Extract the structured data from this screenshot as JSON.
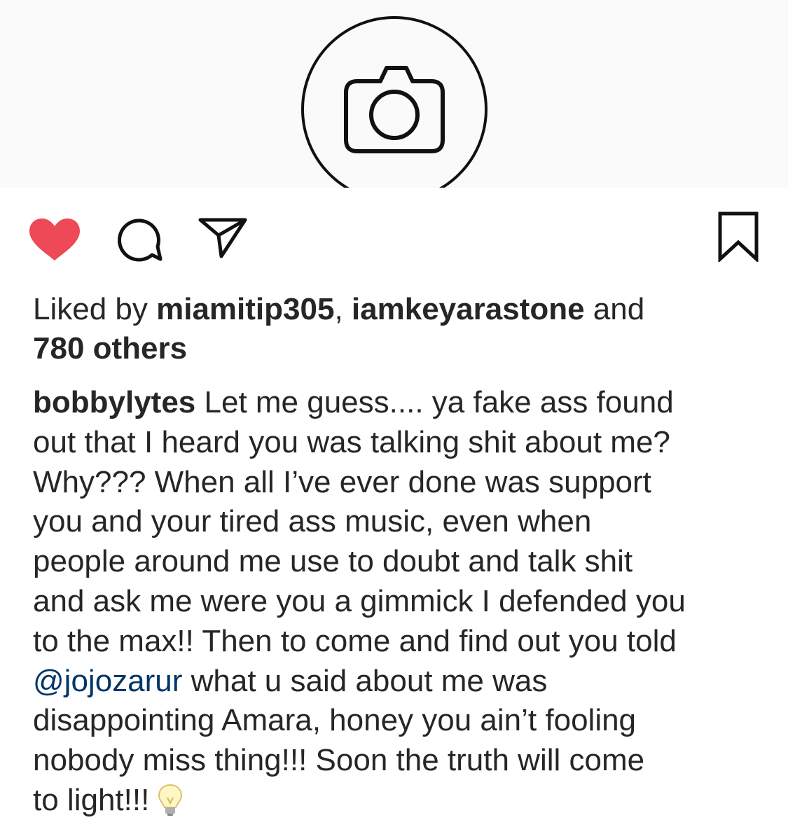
{
  "likes": {
    "prefix": "Liked by ",
    "user1": "miamitip305",
    "separator": ", ",
    "user2": "iamkeyarastone",
    "joiner": " and",
    "others": "780 others"
  },
  "caption": {
    "username": "bobbylytes",
    "line1": " Let me guess.... ya fake ass found",
    "line2": "out that I heard you was talking shit about me?",
    "line3": "Why??? When all I’ve ever done was support",
    "line4": "you and your tired ass music, even when",
    "line5": "people around me use to doubt and talk shit",
    "line6": "and ask me were you a gimmick I defended you",
    "line7": "to the max!! Then to come and find out you told",
    "mention": "@jojozarur",
    "line8_rest": " what u said about me was",
    "line9": "disappointing Amara, honey you ain’t fooling",
    "line10": "nobody miss thing!!! Soon the truth will come",
    "line11": "to light!!!"
  },
  "icons": {
    "media": "camera-icon",
    "like": "heart-icon",
    "comment": "comment-icon",
    "share": "send-icon",
    "save": "bookmark-icon",
    "emoji": "light-bulb-icon"
  },
  "colors": {
    "like_active": "#ed4956",
    "text": "#262626",
    "mention": "#003569",
    "media_background": "#fafafa"
  }
}
